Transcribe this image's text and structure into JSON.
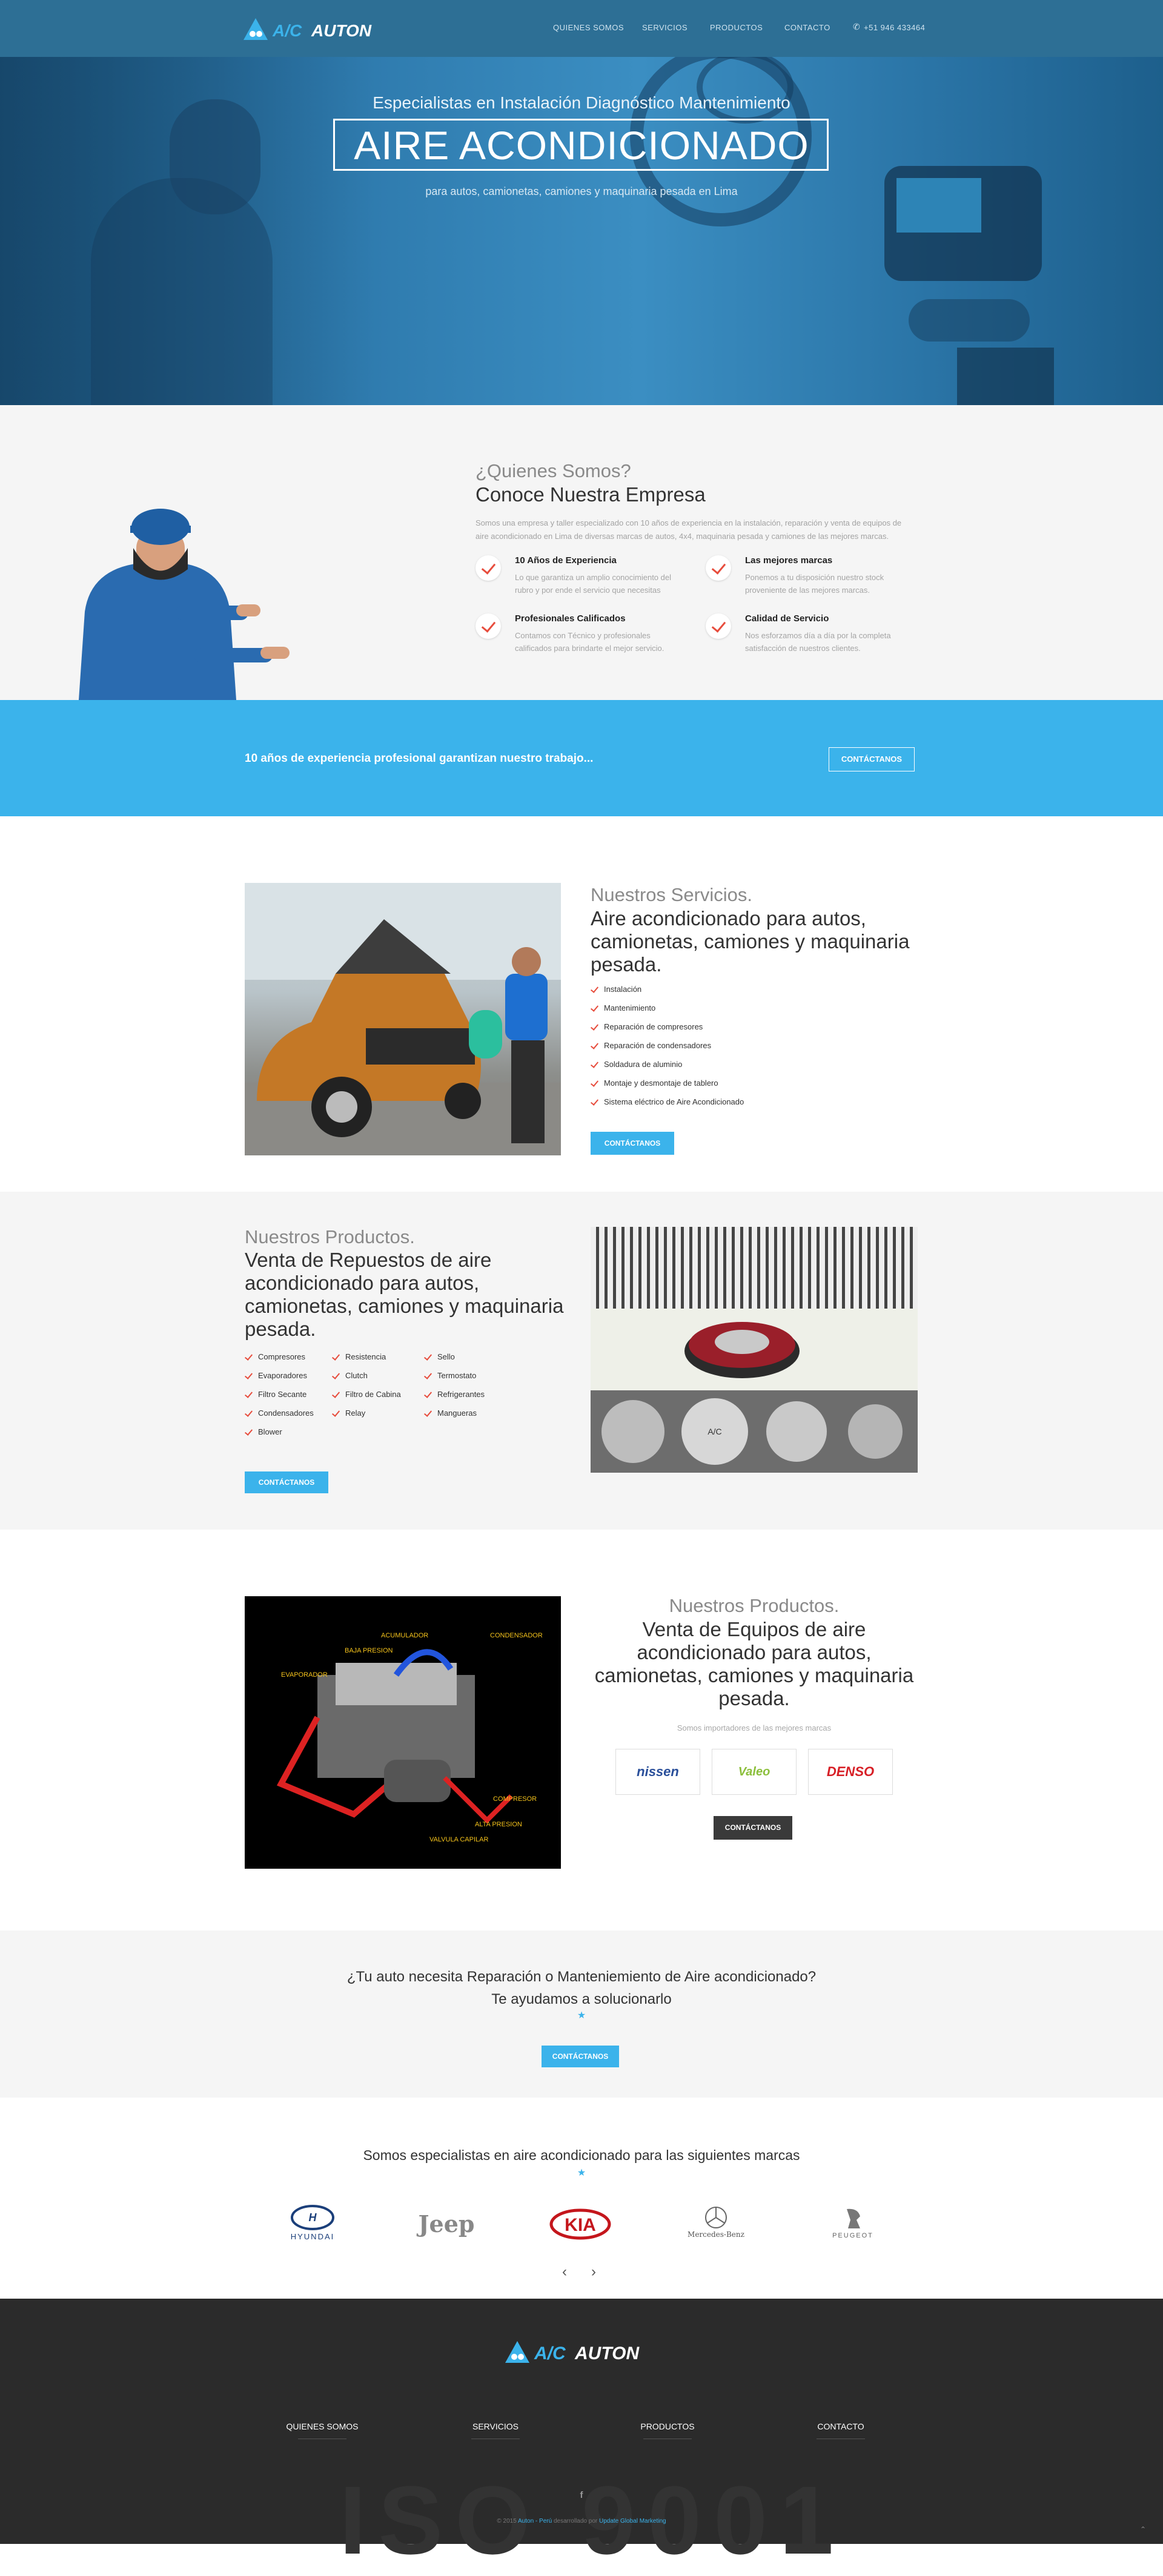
{
  "nav": {
    "logo_text": "A/C AUTON",
    "links": [
      "QUIENES SOMOS",
      "SERVICIOS",
      "PRODUCTOS",
      "CONTACTO"
    ],
    "phone": "+51 946 433464"
  },
  "hero": {
    "pre": "Especialistas en Instalación Diagnóstico Mantenimiento",
    "title": "AIRE ACONDICIONADO",
    "sub": "para autos, camionetas, camiones y maquinaria pesada en Lima"
  },
  "about": {
    "pre": "¿Quienes Somos?",
    "title": "Conoce Nuestra Empresa",
    "desc": "Somos una empresa y taller especializado con 10 años de experiencia en la instalación, reparación y venta de equipos de aire acondicionado en Lima de diversas marcas de autos, 4x4, maquinaria pesada y camiones de las mejores marcas.",
    "features": [
      {
        "title": "10 Años de Experiencia",
        "desc": "Lo que garantiza un amplio conocimiento del rubro y por ende el servicio que necesitas"
      },
      {
        "title": "Las mejores marcas",
        "desc": "Ponemos a tu disposición nuestro stock proveniente de las mejores marcas."
      },
      {
        "title": "Profesionales Calificados",
        "desc": "Contamos con Técnico y profesionales calificados para brindarte el mejor servicio."
      },
      {
        "title": "Calidad de Servicio",
        "desc": "Nos esforzamos día a día por la completa satisfacción de nuestros clientes."
      }
    ]
  },
  "cta1": {
    "text": "10 años de experiencia profesional garantizan nuestro trabajo...",
    "button": "CONTÁCTANOS"
  },
  "services": {
    "pre": "Nuestros Servicios.",
    "title": "Aire acondicionado para autos, camionetas, camiones y maquinaria pesada.",
    "items": [
      "Instalación",
      "Mantenimiento",
      "Reparación de compresores",
      "Reparación de condensadores",
      "Soldadura de aluminio",
      "Montaje y desmontaje de tablero",
      "Sistema eléctrico de Aire Acondicionado"
    ],
    "button": "CONTÁCTANOS"
  },
  "products1": {
    "pre": "Nuestros Productos.",
    "title": "Venta de Repuestos de aire acondicionado para autos, camionetas, camiones y maquinaria pesada.",
    "col1": [
      "Compresores",
      "Evaporadores",
      "Filtro Secante",
      "Condensadores",
      "Blower"
    ],
    "col2": [
      "Resistencia",
      "Clutch",
      "Filtro de Cabina",
      "Relay"
    ],
    "col3": [
      "Sello",
      "Termostato",
      "Refrigerantes",
      "Mangueras"
    ],
    "button": "CONTÁCTANOS"
  },
  "products2": {
    "pre": "Nuestros Productos.",
    "title": "Venta de Equipos de aire acondicionado para autos, camionetas, camiones y maquinaria pesada.",
    "sub": "Somos importadores de las mejores marcas",
    "brands": [
      "nissen",
      "Valeo",
      "DENSO"
    ],
    "button": "CONTÁCTANOS",
    "diagram_labels": [
      "ACUMULADOR",
      "CONDENSADOR",
      "BAJA PRESION",
      "EVAPORADOR",
      "COMPRESOR",
      "ALTA PRESION",
      "VALVULA CAPILAR"
    ]
  },
  "cta2": {
    "text": "¿Tu auto necesita Reparación o Manteniemiento de Aire acondicionado? Te ayudamos a solucionarlo",
    "button": "CONTÁCTANOS"
  },
  "brands": {
    "title": "Somos especialistas en aire acondicionado para las siguientes marcas",
    "items": [
      "HYUNDAI",
      "Jeep",
      "KIA",
      "Mercedes-Benz",
      "PEUGEOT"
    ]
  },
  "footer": {
    "logo_text": "A/C AUTON",
    "links": [
      "QUIENES SOMOS",
      "SERVICIOS",
      "PRODUCTOS",
      "CONTACTO"
    ],
    "social": "f",
    "copy_prefix": "© 2015",
    "copy_brand": "Auton - Perú",
    "copy_mid": "desarrollado por",
    "copy_dev": "Update Global Marketing"
  },
  "colors": {
    "accent": "#3bb3eb",
    "nav": "#2d6f95",
    "check": "#e74c3c",
    "footer": "#2b2b2b"
  }
}
